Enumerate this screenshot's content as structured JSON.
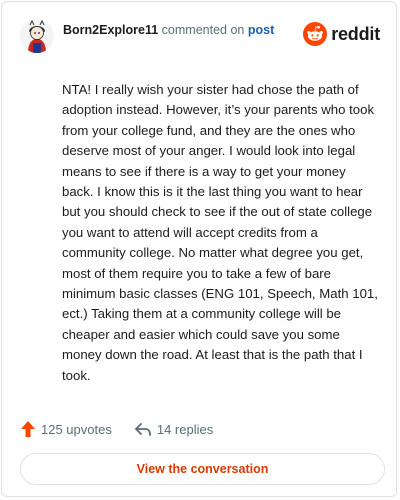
{
  "comment": {
    "username": "Born2Explore11",
    "action_text": "commented on",
    "post_link_text": "post",
    "body": "NTA! I really wish your sister had chose the path of adoption instead. However, it’s your parents who took from your college fund, and they are the ones who deserve most of your anger. I would look into legal means to see if there is a way to get your money back. I know this is it the last thing you want to hear but you should check to see if the out of state college you want to attend will accept credits from a community college. No matter what degree you get, most of them require you to take a few of bare minimum basic classes (ENG 101, Speech, Math 101, ect.) Taking them at a community college will be cheaper and easier which could save you some money down the road. At least that is the path that I took."
  },
  "brand": {
    "name": "reddit",
    "icon": "reddit-snoo-icon",
    "color": "#ff4500"
  },
  "stats": {
    "upvotes": "125 upvotes",
    "replies": "14 replies",
    "upvote_icon": "upvote-arrow-icon",
    "reply_icon": "reply-arrow-icon"
  },
  "footer": {
    "view_button_label": "View the conversation"
  },
  "colors": {
    "accent": "#d93a00",
    "link": "#1a5fb4",
    "muted": "#576f76"
  }
}
